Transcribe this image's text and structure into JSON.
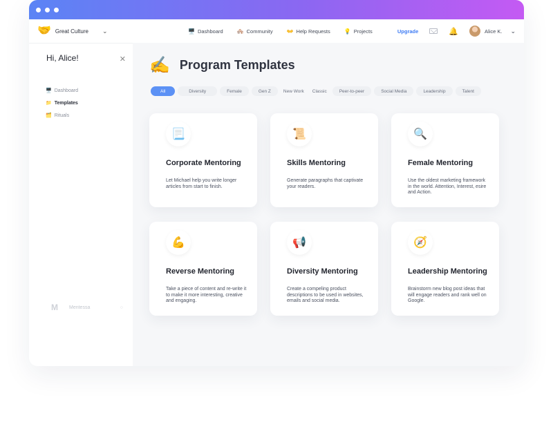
{
  "window": {
    "dots": 3
  },
  "topnav": {
    "workspace": "Great Culture",
    "workspace_icon": "🤝",
    "links": [
      {
        "icon": "🖥️",
        "label": "Dashboard"
      },
      {
        "icon": "🏘️",
        "label": "Community"
      },
      {
        "icon": "👐",
        "label": "Help Requests"
      },
      {
        "icon": "💡",
        "label": "Projects"
      }
    ],
    "upgrade": "Upgrade",
    "bell_icon": "🔔",
    "user_name": "Alice K."
  },
  "sidebar": {
    "greeting": "Hi, Alice!",
    "close": "✕",
    "items": [
      {
        "icon": "🖥️",
        "label": "Dashboard",
        "active": false
      },
      {
        "icon": "📁",
        "label": "Templates",
        "active": true
      },
      {
        "icon": "🗂️",
        "label": "Rituals",
        "active": false
      }
    ],
    "footer_logo": "M",
    "footer_text": "Mentessa"
  },
  "main": {
    "title_icon": "✍️",
    "title": "Program Templates",
    "filters": [
      "All",
      "Diversity",
      "Female",
      "Gen Z",
      "New Work",
      "Classic",
      "Peer-to-peer",
      "Social Media",
      "Leadership",
      "Talent"
    ],
    "cards": [
      {
        "icon": "📃",
        "title": "Corporate Mentoring",
        "desc": "Let Michael help you write longer articles from start to finish."
      },
      {
        "icon": "📜",
        "title": "Skills Mentoring",
        "desc": "Generate paragraphs that captivate your readers."
      },
      {
        "icon": "🔍",
        "title": "Female Mentoring",
        "desc": "Use the oldest marketing framework in the world. Attention, Interest, esire and Action."
      },
      {
        "icon": "💪",
        "title": "Reverse Mentoring",
        "desc": "Take a piece of content and re-write it to make it more interesting, creative and engaging."
      },
      {
        "icon": "📢",
        "title": "Diversity Mentoring",
        "desc": "Create a compeling product descriptions to be used in websites, emails and social media."
      },
      {
        "icon": "🧭",
        "title": "Leadership Mentoring",
        "desc": "Brainstorm new blog post ideas that will engage readers and rank well on Google."
      }
    ]
  }
}
